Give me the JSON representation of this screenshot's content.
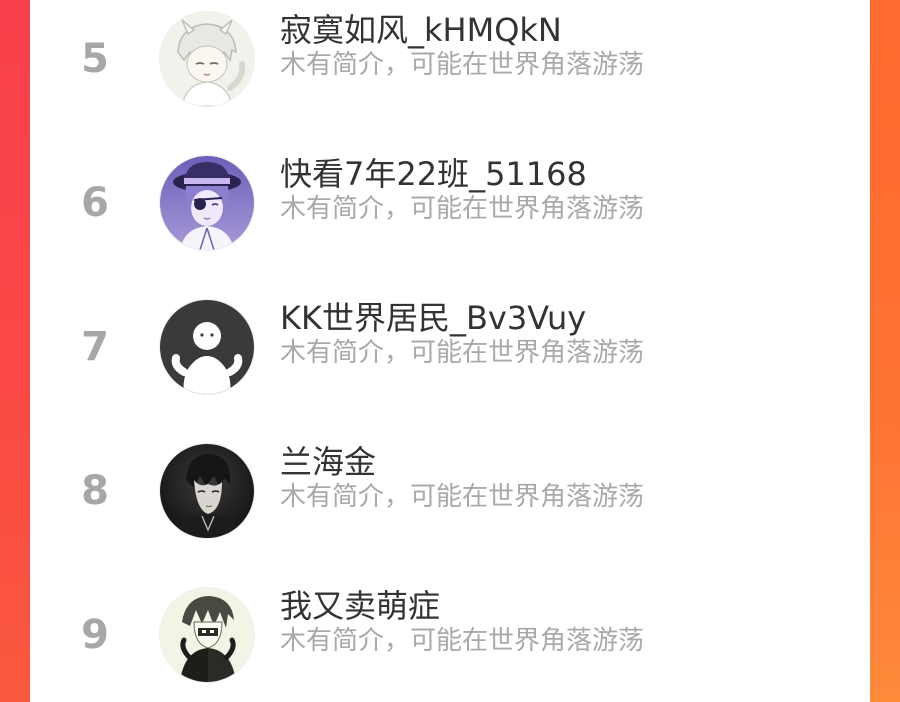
{
  "ranking": {
    "items": [
      {
        "rank": "5",
        "name": "寂寞如风_kHMQkN",
        "bio": "木有简介，可能在世界角落游荡",
        "avatar_icon": "anime-white-hair-boy-avatar"
      },
      {
        "rank": "6",
        "name": "快看7年22班_51168",
        "bio": "木有简介，可能在世界角落游荡",
        "avatar_icon": "anime-purple-hat-boy-avatar"
      },
      {
        "rank": "7",
        "name": "KK世界居民_Bv3Vuy",
        "bio": "木有简介，可能在世界角落游荡",
        "avatar_icon": "default-ghost-avatar"
      },
      {
        "rank": "8",
        "name": "兰海金",
        "bio": "木有简介，可能在世界角落游荡",
        "avatar_icon": "dark-haired-man-avatar"
      },
      {
        "rank": "9",
        "name": "我又卖萌症",
        "bio": "木有简介，可能在世界角落游荡",
        "avatar_icon": "sketch-character-avatar"
      }
    ]
  },
  "colors": {
    "background_red": "#f9424a",
    "background_orange": "#fd7a36",
    "rank_number": "#a7a7a7",
    "name_text": "#333333",
    "bio_text": "#a9a9a9"
  }
}
